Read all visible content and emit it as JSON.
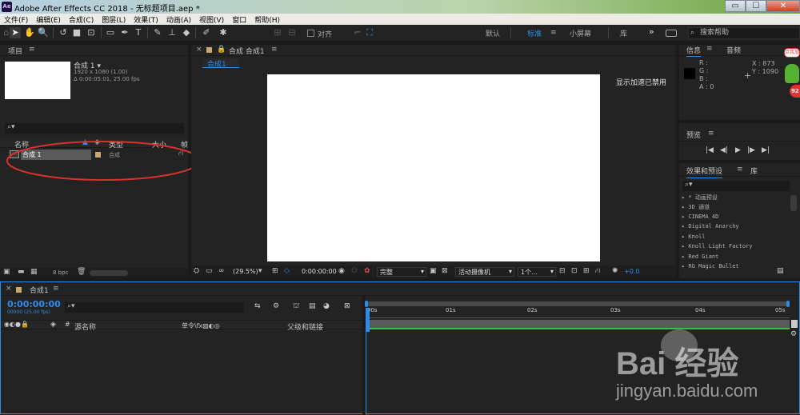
{
  "window": {
    "title": "Adobe After Effects CC 2018 - 无标题项目.aep *",
    "app_icon": "Ae",
    "minimize": "▭",
    "maximize": "☐",
    "close": "✕"
  },
  "menu": [
    "文件(F)",
    "编辑(E)",
    "合成(C)",
    "图层(L)",
    "效果(T)",
    "动画(A)",
    "视图(V)",
    "窗口",
    "帮助(H)"
  ],
  "toolbar": {
    "snap_label": "对齐",
    "workspaces": [
      "默认",
      "标准",
      "小屏幕",
      "库"
    ],
    "active_workspace": "标准",
    "more": "»",
    "search_placeholder": "搜索帮助"
  },
  "project": {
    "title": "项目",
    "comp_name": "合成 1 ▾",
    "comp_res": "1920 x 1080 (1.00)",
    "comp_dur": "Δ 0:00:05:01, 25.00 fps",
    "search_placeholder": "",
    "columns": {
      "name": "名称",
      "type": "类型",
      "size": "大小",
      "fps": "帧"
    },
    "items": [
      {
        "name": "合成 1",
        "type": "合成"
      }
    ],
    "bpc": "8 bpc"
  },
  "composition": {
    "panel_title": "合成 合成1",
    "tab_label": "合成1",
    "accel_msg": "显示加速已禁用",
    "zoom": "(29.5%)",
    "timecode": "0:00:00:00",
    "resolution": "完整",
    "camera": "活动摄像机",
    "views": "1个...",
    "exposure": "+0.0"
  },
  "info": {
    "tabs": [
      "信息",
      "音频"
    ],
    "r": "R :",
    "g": "G :",
    "b": "B :",
    "a": "A : 0",
    "x": "X : 873",
    "y": "Y : 1090",
    "badge_text": "点我加速",
    "badge_num": "92"
  },
  "preview": {
    "title": "预览",
    "controls": [
      "|◀",
      "◀|",
      "▶",
      "|▶",
      "▶|"
    ]
  },
  "effects": {
    "tabs": [
      "效果和预设",
      "库"
    ],
    "search_placeholder": "",
    "items": [
      "▸ * 动画预设",
      "▸ 3D 通道",
      "▸ CINEMA 4D",
      "▸ Digital Anarchy",
      "▸ Knoll",
      "▸ Knoll Light Factory",
      "▸ Red Giant",
      "▸ RG Magic Bullet"
    ]
  },
  "timeline": {
    "tab_label": "合成1",
    "timecode": "0:00:00:00",
    "frames": "00000 (25.00 fps)",
    "search_placeholder": "",
    "col_source": "源名称",
    "col_switches": "单令\\fx▨◐◎",
    "col_parent": "父级和链接",
    "ruler": [
      "00s",
      "01s",
      "02s",
      "03s",
      "04s",
      "05s"
    ]
  },
  "watermark": {
    "logo": "Bai 经验",
    "url": "jingyan.baidu.com"
  },
  "colors": {
    "accent": "#2d8ceb",
    "annotation": "#d6322b",
    "bg": "#232323",
    "canvas": "#ffffff"
  }
}
